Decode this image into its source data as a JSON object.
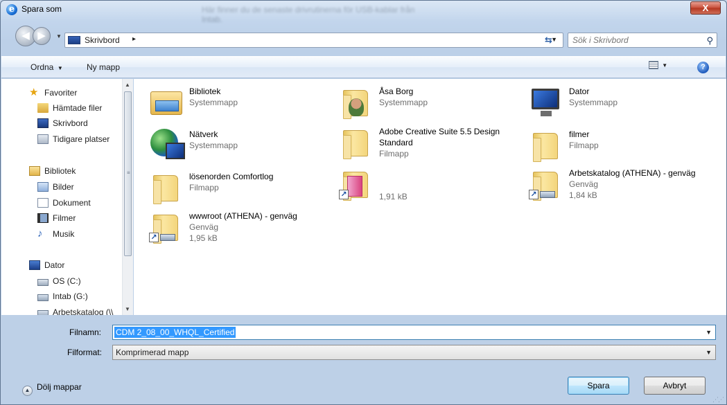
{
  "window": {
    "title": "Spara som",
    "background_caption": "Här finner du de senaste drivrutinerna för USB-kablar från Intab.",
    "close_label": "X"
  },
  "address": {
    "location": "Skrivbord",
    "separator": "▸"
  },
  "search": {
    "placeholder": "Sök i Skrivbord"
  },
  "toolbar": {
    "organize_label": "Ordna",
    "new_folder_label": "Ny mapp"
  },
  "sidebar": {
    "favorites_label": "Favoriter",
    "favorites": [
      {
        "label": "Hämtade filer"
      },
      {
        "label": "Skrivbord"
      },
      {
        "label": "Tidigare platser"
      }
    ],
    "libraries_label": "Bibliotek",
    "libraries": [
      {
        "label": "Bilder"
      },
      {
        "label": "Dokument"
      },
      {
        "label": "Filmer"
      },
      {
        "label": "Musik"
      }
    ],
    "computer_label": "Dator",
    "drives": [
      {
        "label": "OS (C:)"
      },
      {
        "label": "Intab (G:)"
      },
      {
        "label": "Arbetskatalog (\\\\"
      }
    ]
  },
  "files": [
    {
      "name": "Bibliotek",
      "type": "Systemmapp"
    },
    {
      "name": "Åsa Borg",
      "type": "Systemmapp"
    },
    {
      "name": "Dator",
      "type": "Systemmapp"
    },
    {
      "name": "Nätverk",
      "type": "Systemmapp"
    },
    {
      "name": "Adobe Creative Suite 5.5 Design",
      "name_line2": "Standard",
      "type": "Filmapp"
    },
    {
      "name": "filmer",
      "type": "Filmapp"
    },
    {
      "name": "lösenorden Comfortlog",
      "type": "Filmapp"
    },
    {
      "name": "",
      "type": "",
      "size": "1,91 kB"
    },
    {
      "name": "Arbetskatalog (ATHENA) - genväg",
      "type": "Genväg",
      "size": "1,84 kB"
    },
    {
      "name": "wwwroot (ATHENA) - genväg",
      "type": "Genväg",
      "size": "1,95 kB"
    }
  ],
  "form": {
    "filename_label": "Filnamn:",
    "filename_value": "CDM 2_08_00_WHQL_Certified",
    "filetype_label": "Filformat:",
    "filetype_value": "Komprimerad mapp"
  },
  "footer": {
    "hide_folders_label": "Dölj mappar",
    "save_label": "Spara",
    "cancel_label": "Avbryt"
  },
  "colors": {
    "selection": "#3399ff",
    "window_frame": "#bdd0e7",
    "close_button": "#c84f3a"
  }
}
